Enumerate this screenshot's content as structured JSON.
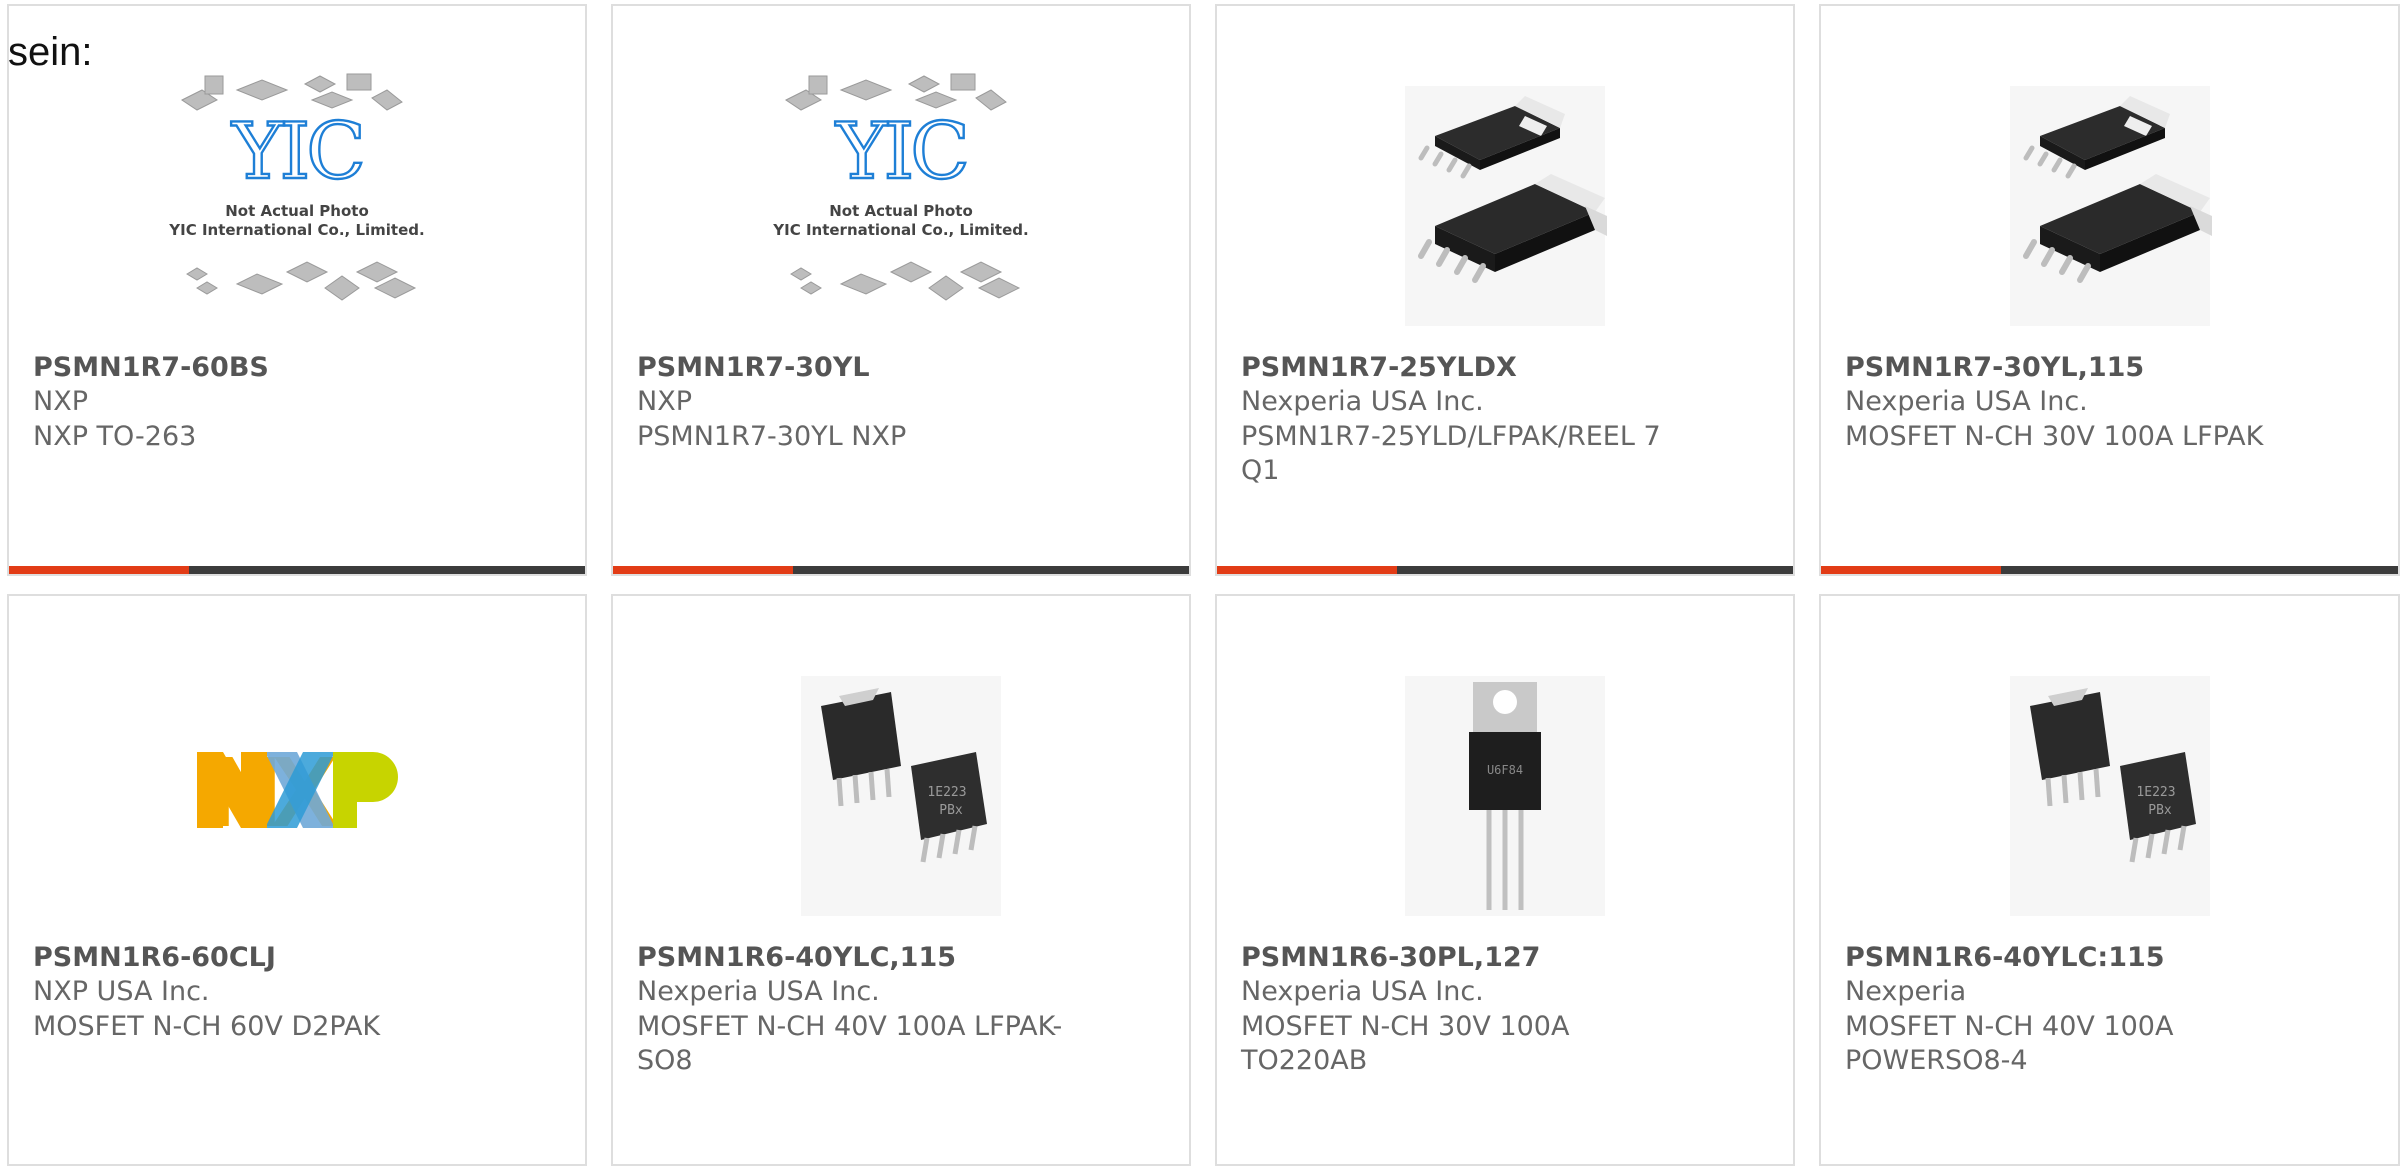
{
  "intro_text": "sein:",
  "colors": {
    "accent": "#e23c16",
    "bar": "#3c3c3c",
    "card_border": "#dedede",
    "title": "#555555",
    "text": "#666666"
  },
  "placeholder": {
    "line1": "Not Actual Photo",
    "line2": "YIC International Co., Limited.",
    "logo": "YIC"
  },
  "products": [
    {
      "name": "PSMN1R7-60BS",
      "manufacturer": "NXP",
      "description": "NXP TO-263",
      "image": "yic-placeholder-image"
    },
    {
      "name": "PSMN1R7-30YL",
      "manufacturer": "NXP",
      "description": "PSMN1R7-30YL NXP",
      "image": "yic-placeholder-image"
    },
    {
      "name": "PSMN1R7-25YLDX",
      "manufacturer": "Nexperia USA Inc.",
      "description": "PSMN1R7-25YLD/LFPAK/REEL 7 Q1",
      "image": "lfpak-package-image"
    },
    {
      "name": "PSMN1R7-30YL,115",
      "manufacturer": "Nexperia USA Inc.",
      "description": "MOSFET N-CH 30V 100A LFPAK",
      "image": "lfpak-package-image"
    },
    {
      "name": "PSMN1R6-60CLJ",
      "manufacturer": "NXP USA Inc.",
      "description": "MOSFET N-CH 60V D2PAK",
      "image": "nxp-logo-image"
    },
    {
      "name": "PSMN1R6-40YLC,115",
      "manufacturer": "Nexperia USA Inc.",
      "description": "MOSFET N-CH 40V 100A LFPAK-SO8",
      "image": "so8-package-image"
    },
    {
      "name": "PSMN1R6-30PL,127",
      "manufacturer": "Nexperia USA Inc.",
      "description": "MOSFET N-CH 30V 100A TO220AB",
      "image": "to220-package-image"
    },
    {
      "name": "PSMN1R6-40YLC:115",
      "manufacturer": "Nexperia",
      "description": "MOSFET N-CH 40V 100A POWERSO8-4",
      "image": "so8-package-image"
    }
  ],
  "logos": {
    "nxp": "NXP"
  },
  "chip_marks": {
    "so8": [
      "1E223",
      "PBx"
    ],
    "to220": "U6F84"
  }
}
